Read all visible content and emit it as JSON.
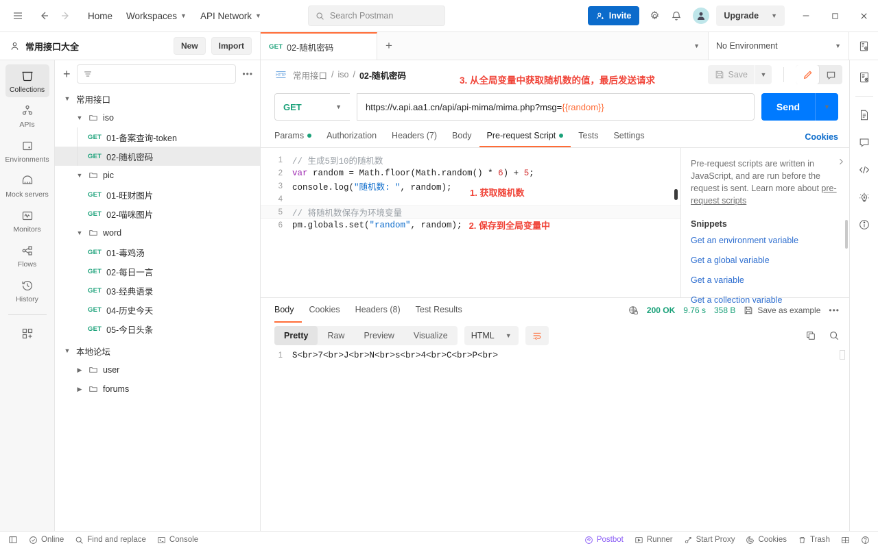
{
  "topbar": {
    "hamburger_icon": "hamburger-icon",
    "back_icon": "back-arrow-icon",
    "forward_icon": "forward-arrow-icon",
    "home_label": "Home",
    "workspaces_label": "Workspaces",
    "api_network_label": "API Network",
    "search_placeholder": "Search Postman",
    "invite_label": "Invite",
    "settings_icon": "gear-icon",
    "notifications_icon": "bell-icon",
    "avatar_label": "A",
    "upgrade_label": "Upgrade",
    "minimize_icon": "minimize-icon",
    "maximize_icon": "maximize-icon",
    "close_icon": "close-icon"
  },
  "workspace": {
    "name": "常用接口大全",
    "new_label": "New",
    "import_label": "Import"
  },
  "tabs": {
    "open": [
      {
        "method": "GET",
        "title": "02-随机密码",
        "active": true
      }
    ],
    "new_tab_icon": "plus-icon",
    "tab_list_caret_icon": "chevron-down-icon"
  },
  "environment": {
    "selected": "No Environment",
    "eye_icon": "environment-quick-look-icon"
  },
  "rail": {
    "items": [
      {
        "label": "Collections",
        "icon": "collections-icon",
        "active": true
      },
      {
        "label": "APIs",
        "icon": "apis-icon",
        "active": false
      },
      {
        "label": "Environments",
        "icon": "environments-icon",
        "active": false
      },
      {
        "label": "Mock servers",
        "icon": "mock-servers-icon",
        "active": false
      },
      {
        "label": "Monitors",
        "icon": "monitors-icon",
        "active": false
      },
      {
        "label": "Flows",
        "icon": "flows-icon",
        "active": false
      },
      {
        "label": "History",
        "icon": "history-icon",
        "active": false
      }
    ],
    "more_label": "",
    "more_icon": "add-module-icon"
  },
  "sidebar": {
    "create_icon": "plus-icon",
    "filter_icon": "filter-icon",
    "filter_placeholder": "",
    "more_icon": "ellipsis-icon",
    "tree": [
      {
        "label": "常用接口",
        "type": "collection",
        "depth": 0,
        "expanded": true,
        "selected": false
      },
      {
        "label": "iso",
        "type": "folder",
        "depth": 1,
        "expanded": true,
        "selected": false
      },
      {
        "label": "01-备案查询-token",
        "type": "request",
        "method": "GET",
        "depth": 2,
        "selected": false
      },
      {
        "label": "02-随机密码",
        "type": "request",
        "method": "GET",
        "depth": 2,
        "selected": true
      },
      {
        "label": "pic",
        "type": "folder",
        "depth": 1,
        "expanded": true,
        "selected": false
      },
      {
        "label": "01-旺财图片",
        "type": "request",
        "method": "GET",
        "depth": 2,
        "selected": false
      },
      {
        "label": "02-喵咪图片",
        "type": "request",
        "method": "GET",
        "depth": 2,
        "selected": false
      },
      {
        "label": "word",
        "type": "folder",
        "depth": 1,
        "expanded": true,
        "selected": false
      },
      {
        "label": "01-毒鸡汤",
        "type": "request",
        "method": "GET",
        "depth": 2,
        "selected": false
      },
      {
        "label": "02-每日一言",
        "type": "request",
        "method": "GET",
        "depth": 2,
        "selected": false
      },
      {
        "label": "03-经典语录",
        "type": "request",
        "method": "GET",
        "depth": 2,
        "selected": false
      },
      {
        "label": "04-历史今天",
        "type": "request",
        "method": "GET",
        "depth": 2,
        "selected": false
      },
      {
        "label": "05-今日头条",
        "type": "request",
        "method": "GET",
        "depth": 2,
        "selected": false
      },
      {
        "label": "本地论坛",
        "type": "collection",
        "depth": 0,
        "expanded": true,
        "selected": false
      },
      {
        "label": "user",
        "type": "folder",
        "depth": 1,
        "expanded": false,
        "selected": false
      },
      {
        "label": "forums",
        "type": "folder",
        "depth": 1,
        "expanded": false,
        "selected": false
      }
    ]
  },
  "request": {
    "protocol_icon": "http-icon",
    "breadcrumb": [
      "常用接口",
      "iso",
      "02-随机密码"
    ],
    "save_label": "Save",
    "save_icon": "save-icon",
    "save_caret_icon": "chevron-down-icon",
    "edit_icon": "pencil-icon",
    "comment_icon": "comment-icon",
    "method": "GET",
    "url_text": "https://v.api.aa1.cn/api/api-mima/mima.php?msg=",
    "url_variable": "{{random}}",
    "send_label": "Send",
    "send_caret_icon": "chevron-down-icon",
    "cookies_label": "Cookies",
    "tabs": [
      {
        "label": "Params",
        "dot": true,
        "active": false
      },
      {
        "label": "Authorization",
        "dot": false,
        "active": false
      },
      {
        "label": "Headers (7)",
        "dot": false,
        "active": false
      },
      {
        "label": "Body",
        "dot": false,
        "active": false
      },
      {
        "label": "Pre-request Script",
        "dot": true,
        "active": true
      },
      {
        "label": "Tests",
        "dot": false,
        "active": false
      },
      {
        "label": "Settings",
        "dot": false,
        "active": false
      }
    ]
  },
  "annotations": {
    "step3": "3. 从全局变量中获取随机数的值，最后发送请求",
    "step1": "1. 获取随机数",
    "step2": "2. 保存到全局变量中"
  },
  "script": {
    "lines": [
      {
        "n": "1",
        "tokens": [
          {
            "t": "// 生成5到10的随机数",
            "c": "c-com"
          }
        ]
      },
      {
        "n": "2",
        "tokens": [
          {
            "t": "var",
            "c": "c-kw"
          },
          {
            "t": " random ",
            "c": "c-op"
          },
          {
            "t": "=",
            "c": "c-op"
          },
          {
            "t": " Math.floor(Math.random() ",
            "c": "c-fn"
          },
          {
            "t": "*",
            "c": "c-op"
          },
          {
            "t": " ",
            "c": "c-op"
          },
          {
            "t": "6",
            "c": "c-num"
          },
          {
            "t": ") ",
            "c": "c-op"
          },
          {
            "t": "+",
            "c": "c-op"
          },
          {
            "t": " ",
            "c": "c-op"
          },
          {
            "t": "5",
            "c": "c-num"
          },
          {
            "t": ";",
            "c": "c-op"
          }
        ]
      },
      {
        "n": "3",
        "tokens": [
          {
            "t": "console.log(",
            "c": "c-fn"
          },
          {
            "t": "\"随机数: \"",
            "c": "c-str"
          },
          {
            "t": ", random);",
            "c": "c-op"
          }
        ]
      },
      {
        "n": "4",
        "tokens": []
      },
      {
        "n": "5",
        "highlight": true,
        "tokens": [
          {
            "t": "// 将随机数保存为环境变量",
            "c": "c-com"
          }
        ]
      },
      {
        "n": "6",
        "tokens": [
          {
            "t": "pm.globals.set(",
            "c": "c-fn"
          },
          {
            "t": "\"random\"",
            "c": "c-str"
          },
          {
            "t": ", random);",
            "c": "c-op"
          }
        ]
      }
    ]
  },
  "help": {
    "paragraph": "Pre-request scripts are written in JavaScript, and are run before the request is sent. Learn more about ",
    "link": "pre-request scripts",
    "snippets_title": "Snippets",
    "snippets": [
      "Get an environment variable",
      "Get a global variable",
      "Get a variable",
      "Get a collection variable"
    ],
    "collapse_icon": "chevron-right-icon"
  },
  "response": {
    "tabs": [
      {
        "label": "Body",
        "active": true
      },
      {
        "label": "Cookies",
        "active": false
      },
      {
        "label": "Headers (8)",
        "active": false
      },
      {
        "label": "Test Results",
        "active": false
      }
    ],
    "globe_icon": "globe-lock-icon",
    "status": "200 OK",
    "time": "9.76 s",
    "size": "358 B",
    "save_example_label": "Save as example",
    "save_example_icon": "save-icon",
    "more_icon": "ellipsis-icon",
    "view_modes": [
      {
        "label": "Pretty",
        "active": true
      },
      {
        "label": "Raw",
        "active": false
      },
      {
        "label": "Preview",
        "active": false
      },
      {
        "label": "Visualize",
        "active": false
      }
    ],
    "format": "HTML",
    "format_caret_icon": "chevron-down-icon",
    "wrap_icon": "wrap-lines-icon",
    "copy_icon": "copy-icon",
    "search_icon": "search-icon",
    "body_lines": [
      {
        "n": "1",
        "text": "S<br>7<br>J<br>N<br>s<br>4<br>C<br>P<br>"
      }
    ]
  },
  "right_rail": {
    "items": [
      {
        "icon": "environment-quick-look-icon",
        "name": "environment-quick-look"
      },
      {
        "icon": "documentation-icon",
        "name": "documentation"
      },
      {
        "icon": "comments-icon",
        "name": "comments"
      },
      {
        "icon": "code-icon",
        "name": "code-snippet"
      },
      {
        "icon": "lightbulb-icon",
        "name": "postbot-suggestions"
      },
      {
        "icon": "info-icon",
        "name": "info"
      }
    ]
  },
  "statusbar": {
    "layout_icon": "sidebar-toggle-icon",
    "online_label": "Online",
    "online_icon": "check-circle-icon",
    "find_label": "Find and replace",
    "find_icon": "search-icon",
    "console_label": "Console",
    "console_icon": "console-icon",
    "postbot_label": "Postbot",
    "postbot_icon": "postbot-icon",
    "runner_label": "Runner",
    "runner_icon": "play-icon",
    "proxy_label": "Start Proxy",
    "proxy_icon": "proxy-icon",
    "cookies_label": "Cookies",
    "cookies_icon": "cookie-icon",
    "trash_label": "Trash",
    "trash_icon": "trash-icon",
    "panes_icon": "panes-icon",
    "help_icon": "help-circle-icon"
  },
  "colors": {
    "accent": "#ff6c37",
    "send_blue": "#007aff",
    "invite_blue": "#0b6bcb",
    "get_green": "#1aa179",
    "annotation_red": "#f04438",
    "link_blue": "#2f6fd0"
  }
}
